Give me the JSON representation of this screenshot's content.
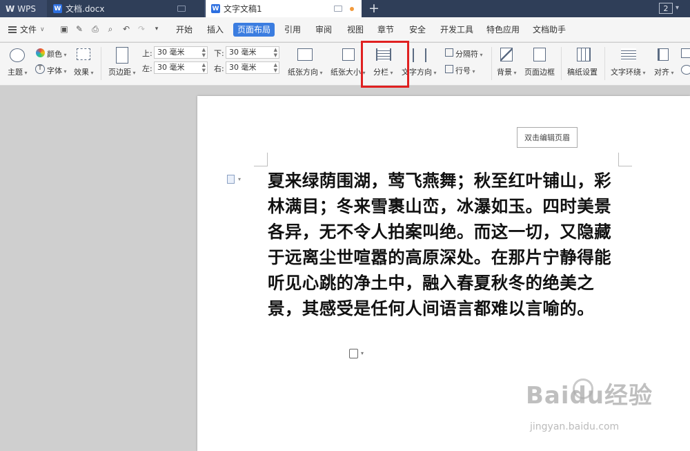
{
  "titlebar": {
    "app_tab": "WPS",
    "doc_tab": "文档.docx",
    "active_tab": "文字文稿1",
    "window_count": "2"
  },
  "menubar": {
    "file_label": "文件",
    "items": [
      "开始",
      "插入",
      "页面布局",
      "引用",
      "审阅",
      "视图",
      "章节",
      "安全",
      "开发工具",
      "特色应用",
      "文档助手"
    ],
    "active_item": "页面布局"
  },
  "ribbon": {
    "theme": "主题",
    "color": "颜色",
    "font": "字体",
    "effect": "效果",
    "margins": "页边距",
    "margin_top_label": "上:",
    "margin_top_value": "30 毫米",
    "margin_bottom_label": "下:",
    "margin_bottom_value": "30 毫米",
    "margin_left_label": "左:",
    "margin_left_value": "30 毫米",
    "margin_right_label": "右:",
    "margin_right_value": "30 毫米",
    "orientation": "纸张方向",
    "paper_size": "纸张大小",
    "columns": "分栏",
    "text_direction": "文字方向",
    "separator": "分隔符",
    "line_number": "行号",
    "background": "背景",
    "page_border": "页面边框",
    "manuscript": "稿纸设置",
    "text_wrap": "文字环绕",
    "align": "对齐",
    "highlight_color": "#e02020"
  },
  "document": {
    "header_hint": "双击编辑页眉",
    "paragraph": "夏来绿荫围湖，莺飞燕舞；秋至红叶铺山，彩林满目；冬来雪裹山峦，冰瀑如玉。四时美景各异，无不令人拍案叫绝。而这一切，又隐藏于远离尘世喧嚣的高原深处。在那片宁静得能听见心跳的净土中，融入春夏秋冬的绝美之景，其感受是任何人间语言都难以言喻的。"
  },
  "watermark": {
    "brand": "Baidu经验",
    "url": "jingyan.baidu.com"
  }
}
